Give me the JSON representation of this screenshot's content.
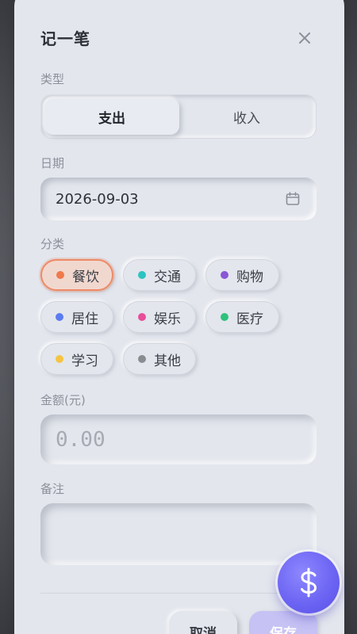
{
  "dialog": {
    "title": "记一笔",
    "close_icon": "close-icon"
  },
  "type_section": {
    "label": "类型",
    "options": [
      "支出",
      "收入"
    ],
    "selected": "支出"
  },
  "date_section": {
    "label": "日期",
    "value": "2026-09-03",
    "icon": "calendar-icon"
  },
  "category_section": {
    "label": "分类",
    "selected": "餐饮",
    "items": [
      {
        "label": "餐饮",
        "color": "#f07a4a"
      },
      {
        "label": "交通",
        "color": "#2cc4c0"
      },
      {
        "label": "购物",
        "color": "#8a55d6"
      },
      {
        "label": "居住",
        "color": "#5a7cf0"
      },
      {
        "label": "娱乐",
        "color": "#e84e9a"
      },
      {
        "label": "医疗",
        "color": "#2fc27a"
      },
      {
        "label": "学习",
        "color": "#f5c542"
      },
      {
        "label": "其他",
        "color": "#8a8d90"
      }
    ]
  },
  "amount_section": {
    "label": "金额(元)",
    "placeholder": "0.00"
  },
  "note_section": {
    "label": "备注",
    "placeholder": ""
  },
  "actions": {
    "cancel_label": "取消",
    "save_label": "保存"
  },
  "fab": {
    "symbol": "$",
    "icon": "dollar-icon",
    "color": "#6a62f2"
  }
}
